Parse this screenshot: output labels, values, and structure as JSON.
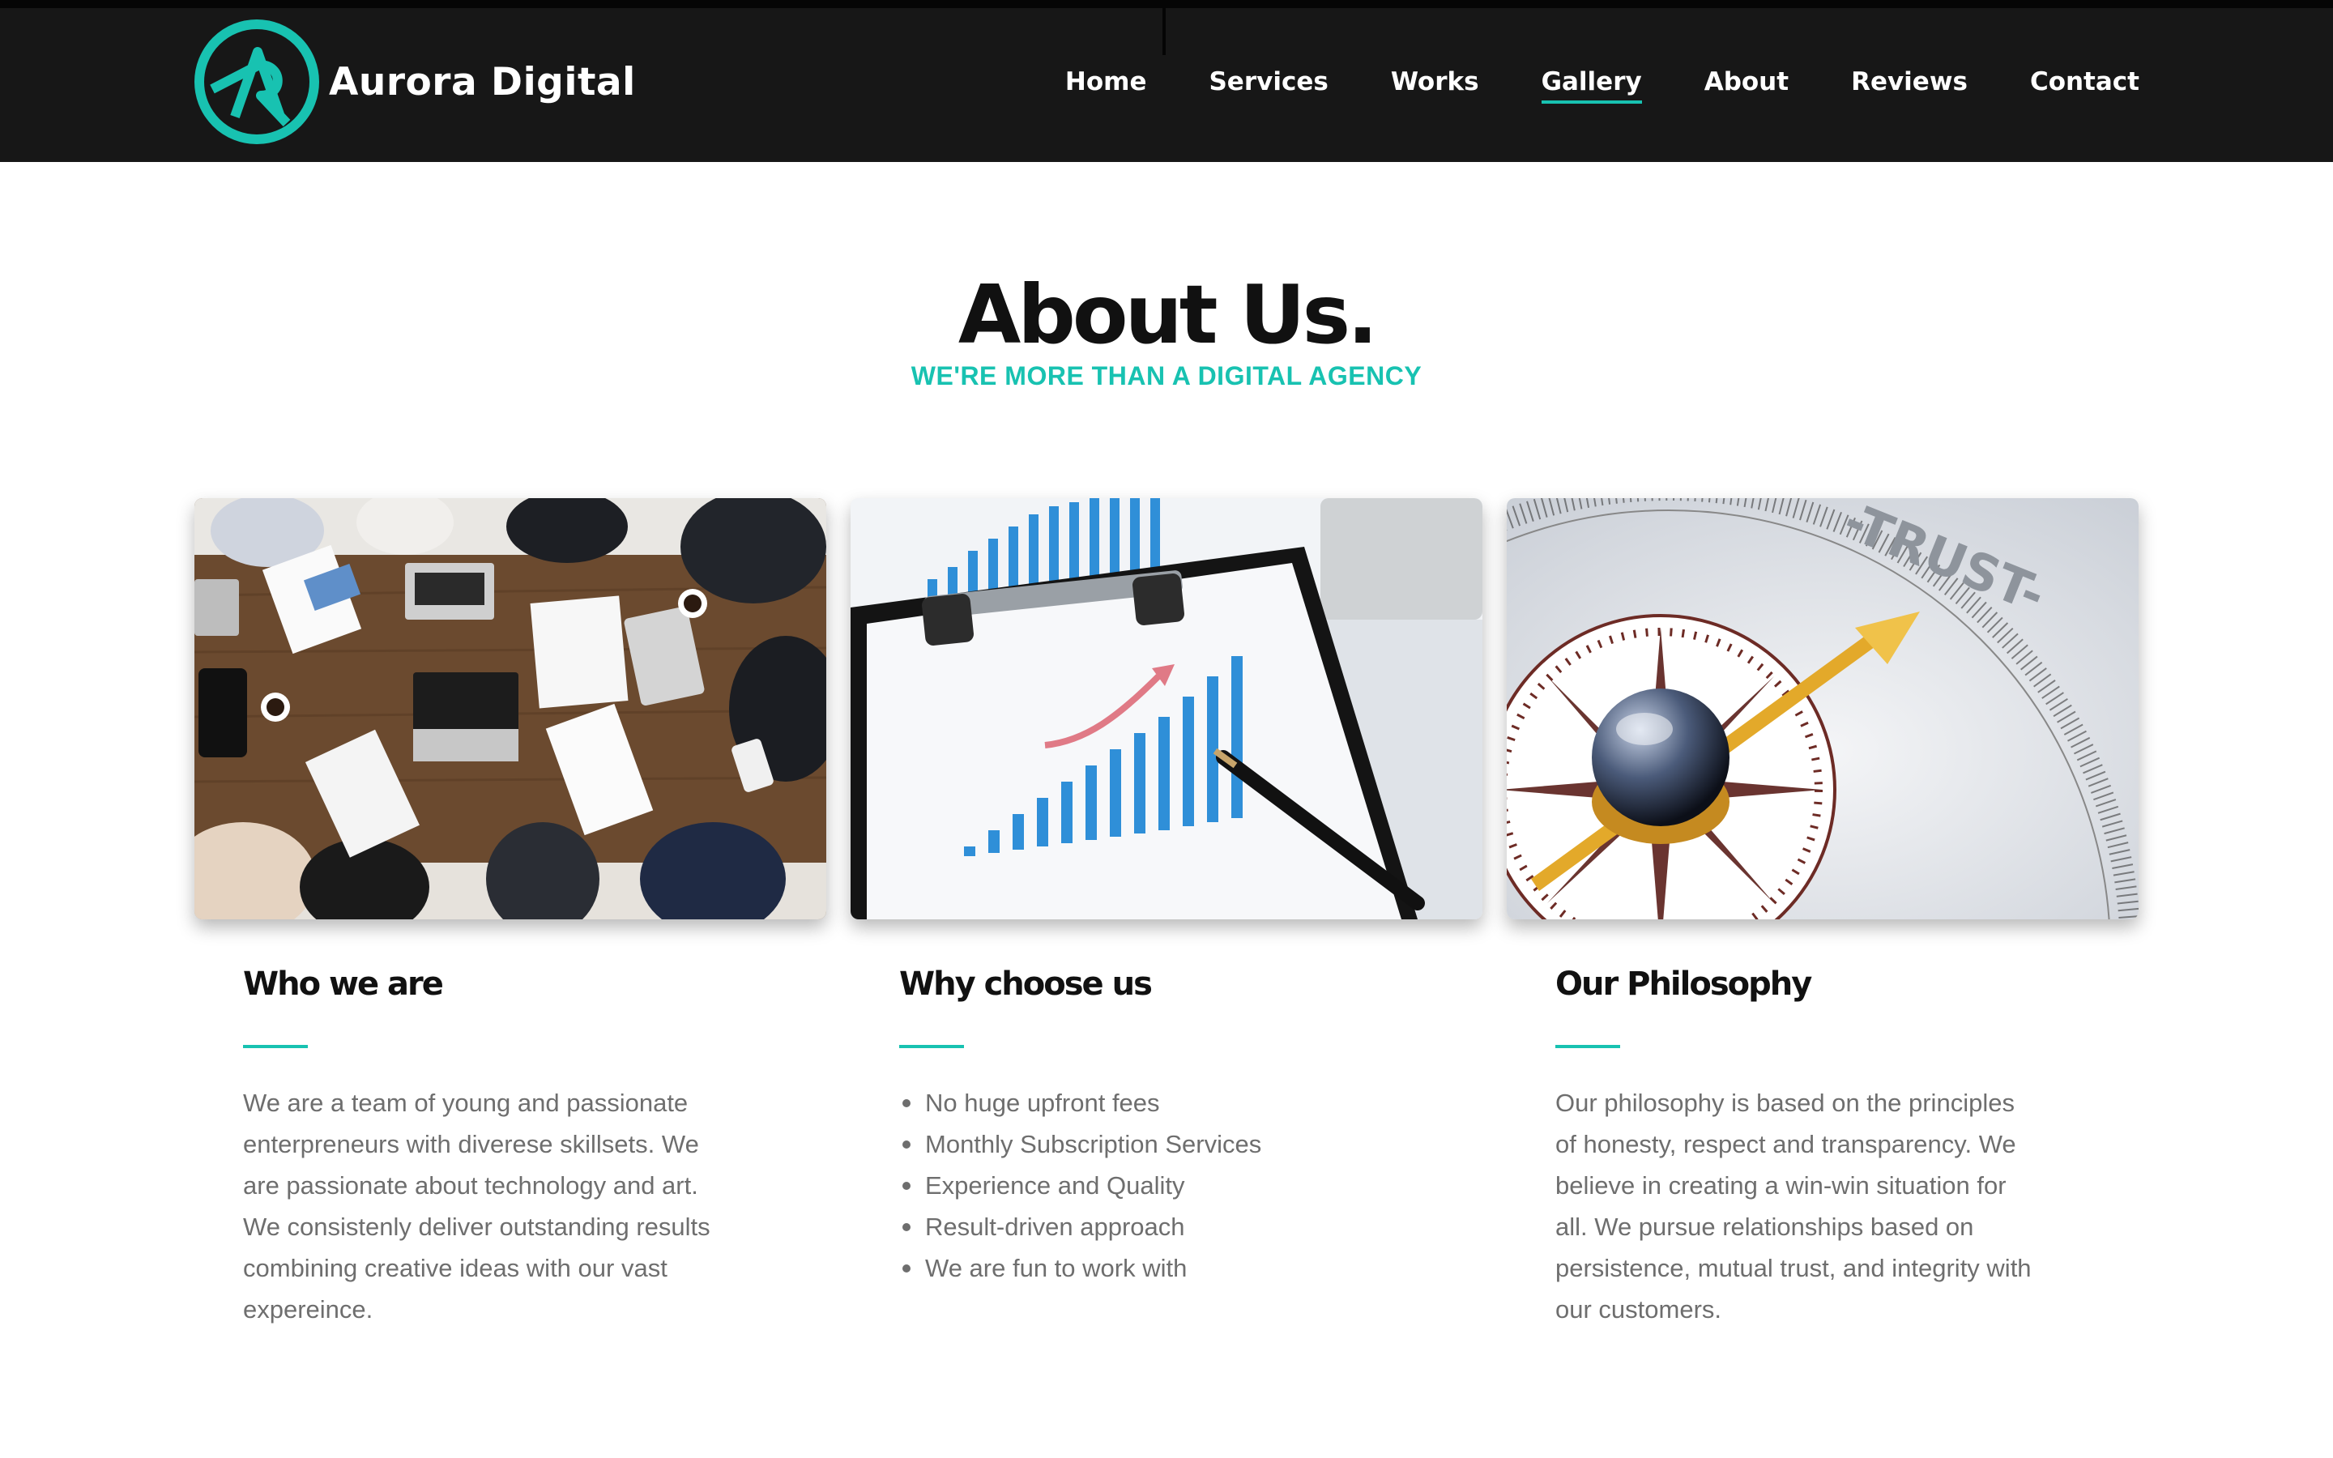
{
  "brand": {
    "name": "Aurora Digital",
    "logo_icon": "aurora-a-logo",
    "accent": "#18c2b1",
    "header_bg": "#171717"
  },
  "nav": {
    "items": [
      "Home",
      "Services",
      "Works",
      "Gallery",
      "About",
      "Reviews",
      "Contact"
    ],
    "active": "Gallery"
  },
  "hero": {
    "title": "About Us.",
    "subtitle": "WE'RE MORE THAN A DIGITAL AGENCY"
  },
  "columns": [
    {
      "image": "team-meeting-photo",
      "title": "Who we are",
      "text": "We are a team of young and passionate enterpreneurs with diverese skillsets. We are passionate about technology and art. We consistenly deliver outstanding results combining creative ideas with our vast expereince."
    },
    {
      "image": "bar-chart-clipboard-photo",
      "title": "Why choose us",
      "bullets": [
        "No huge upfront fees",
        "Monthly Subscription Services",
        "Experience and Quality",
        "Result-driven approach",
        "We are fun to work with"
      ]
    },
    {
      "image": "trust-compass-photo",
      "title": "Our Philosophy",
      "text": "Our philosophy is based on the principles of honesty, respect and transparency. We believe in creating a win-win situation for all. We pursue relationships based on persistence, mutual trust, and integrity with our customers.",
      "image_caption": "-TRUST-"
    }
  ]
}
